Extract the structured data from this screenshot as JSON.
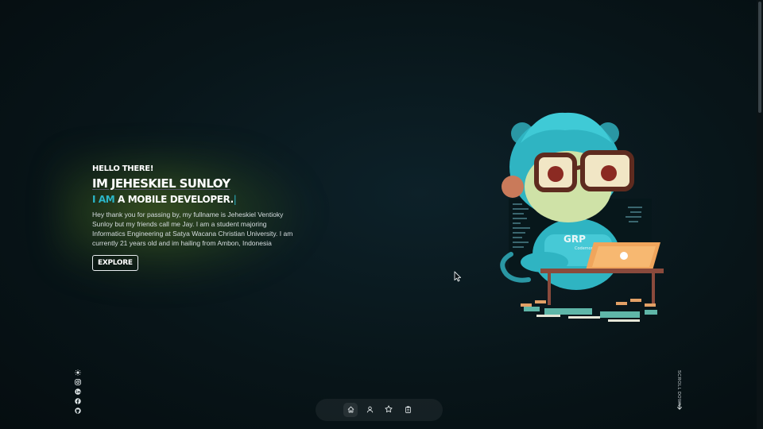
{
  "hero": {
    "greeting": "HELLO THERE!",
    "name": "IM JEHESKIEL SUNLOY",
    "role_prefix": "I AM",
    "role_rest": " A MOBILE DEVELOPER.",
    "role_cursor": "|",
    "description": "Hey thank you for passing by, my fullname is Jeheskiel Ventioky Sunloy but my friends call me Jay. I am a student majoring Informatics Engineering at Satya Wacana Christian University. I am currently 21 years old and im hailing from Ambon, Indonesia",
    "cta_label": "EXPLORE"
  },
  "mascot": {
    "laptop_sticker": "GRP",
    "shirt_text": "GRP",
    "shirt_subtext": "Codemon"
  },
  "socials": [
    {
      "icon": "theme-sun-icon"
    },
    {
      "icon": "instagram-icon"
    },
    {
      "icon": "linkedin-icon"
    },
    {
      "icon": "facebook-icon"
    },
    {
      "icon": "github-icon"
    }
  ],
  "dock": [
    {
      "icon": "home-icon",
      "active": true
    },
    {
      "icon": "user-icon",
      "active": false
    },
    {
      "icon": "star-icon",
      "active": false
    },
    {
      "icon": "clipboard-icon",
      "active": false
    }
  ],
  "scroll_hint": "SCROLL DOWN",
  "colors": {
    "accent": "#2bb6c8",
    "background": "#081519",
    "glow": "#7da028"
  }
}
